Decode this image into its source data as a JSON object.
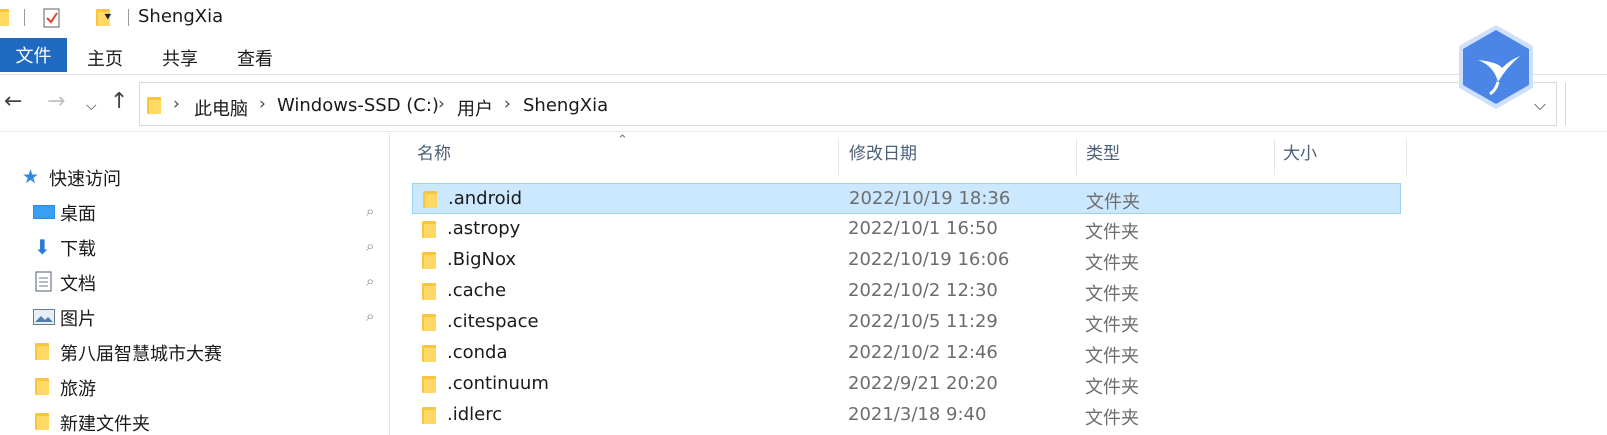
{
  "window": {
    "title": "ShengXia"
  },
  "ribbon": {
    "tabs": [
      "文件",
      "主页",
      "共享",
      "查看"
    ]
  },
  "address": {
    "crumbs": [
      "此电脑",
      "Windows-SSD (C:)",
      "用户",
      "ShengXia"
    ]
  },
  "navpane": {
    "quick_access": "快速访问",
    "items": [
      {
        "label": "桌面",
        "icon": "desktop-icon",
        "pinned": true
      },
      {
        "label": "下载",
        "icon": "download-icon",
        "pinned": true
      },
      {
        "label": "文档",
        "icon": "document-icon",
        "pinned": true
      },
      {
        "label": "图片",
        "icon": "pictures-icon",
        "pinned": true
      },
      {
        "label": "第八届智慧城市大赛",
        "icon": "folder-icon",
        "pinned": false
      },
      {
        "label": "旅游",
        "icon": "folder-icon",
        "pinned": false
      },
      {
        "label": "新建文件夹",
        "icon": "folder-icon",
        "pinned": false
      }
    ]
  },
  "filelist": {
    "headers": {
      "name": "名称",
      "date": "修改日期",
      "type": "类型",
      "size": "大小"
    },
    "rows": [
      {
        "name": ".android",
        "date": "2022/10/19 18:36",
        "type": "文件夹",
        "selected": true
      },
      {
        "name": ".astropy",
        "date": "2022/10/1 16:50",
        "type": "文件夹"
      },
      {
        "name": ".BigNox",
        "date": "2022/10/19 16:06",
        "type": "文件夹"
      },
      {
        "name": ".cache",
        "date": "2022/10/2 12:30",
        "type": "文件夹"
      },
      {
        "name": ".citespace",
        "date": "2022/10/5 11:29",
        "type": "文件夹"
      },
      {
        "name": ".conda",
        "date": "2022/10/2 12:46",
        "type": "文件夹"
      },
      {
        "name": ".continuum",
        "date": "2022/9/21 20:20",
        "type": "文件夹"
      },
      {
        "name": ".idlerc",
        "date": "2021/3/18 9:40",
        "type": "文件夹"
      }
    ]
  },
  "colors": {
    "accent": "#1d6ac0",
    "selection": "#cce8ff",
    "folder": "#f6c640"
  }
}
